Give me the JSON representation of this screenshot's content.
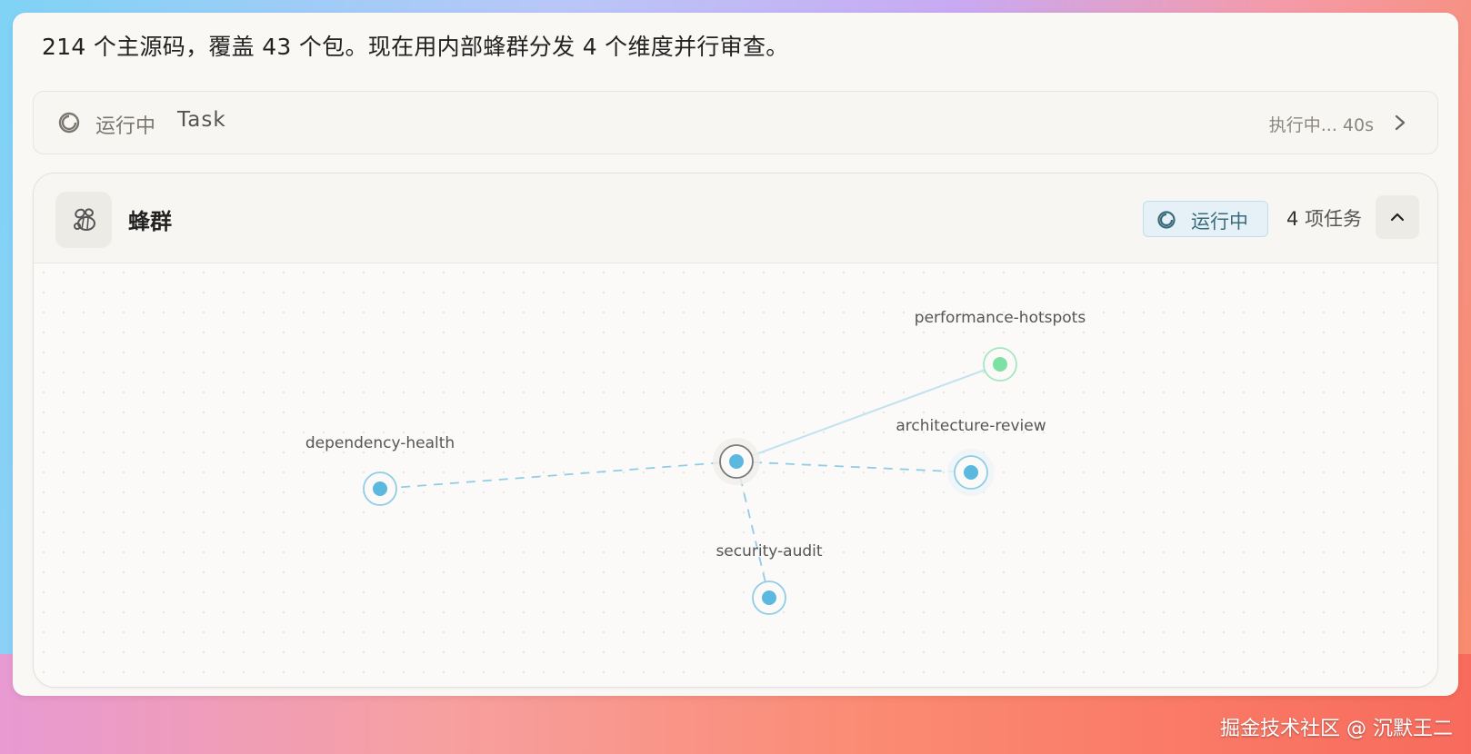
{
  "message": "214 个主源码，覆盖 43 个包。现在用内部蜂群分发 4 个维度并行审查。",
  "task_bar": {
    "status": "运行中",
    "name": "Task",
    "elapsed": "执行中... 40s",
    "spinner_icon": "spinner-icon",
    "chevron_icon": "chevron-right-icon"
  },
  "swarm": {
    "title": "蜂群",
    "icon": "bee-icon",
    "status_label": "运行中",
    "task_count": "4",
    "task_count_suffix": "项任务",
    "collapse_icon": "chevron-up-icon",
    "accent_color": "#5bb8de",
    "done_color": "#7fe0a3",
    "nodes": [
      {
        "id": "coordinator",
        "label": ""
      },
      {
        "id": "performance-hotspots",
        "label": "performance-hotspots",
        "state": "done"
      },
      {
        "id": "architecture-review",
        "label": "architecture-review",
        "state": "running"
      },
      {
        "id": "dependency-health",
        "label": "dependency-health",
        "state": "running"
      },
      {
        "id": "security-audit",
        "label": "security-audit",
        "state": "running"
      }
    ]
  },
  "watermark": "掘金技术社区 @ 沉默王二"
}
